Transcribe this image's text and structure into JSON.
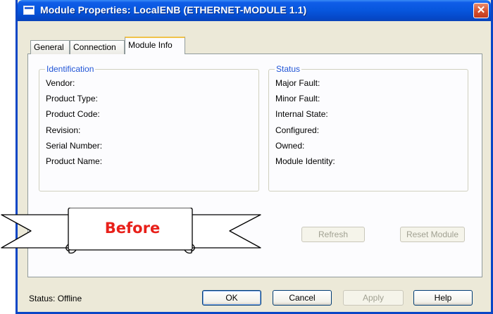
{
  "window": {
    "title": "Module Properties: LocalENB (ETHERNET-MODULE 1.1)",
    "close_glyph": "✕"
  },
  "tabs": [
    {
      "label": "General",
      "active": false
    },
    {
      "label": "Connection",
      "active": false
    },
    {
      "label": "Module Info",
      "active": true
    }
  ],
  "identification": {
    "legend": "Identification",
    "fields": [
      "Vendor:",
      "Product Type:",
      "Product Code:",
      "Revision:",
      "Serial Number:",
      "Product Name:"
    ]
  },
  "status_group": {
    "legend": "Status",
    "fields": [
      "Major Fault:",
      "Minor Fault:",
      "Internal State:",
      "Configured:",
      "Owned:",
      "Module Identity:"
    ]
  },
  "panel_buttons": {
    "refresh": "Refresh",
    "reset_module": "Reset Module"
  },
  "footer": {
    "status": "Status:  Offline",
    "ok": "OK",
    "cancel": "Cancel",
    "apply": "Apply",
    "help": "Help"
  },
  "overlay": {
    "label": "Before",
    "label_color": "#e8201a"
  },
  "colors": {
    "titlebar": "#0756dd",
    "legend_text": "#2155d6",
    "dialog_bg": "#ece9d8"
  }
}
